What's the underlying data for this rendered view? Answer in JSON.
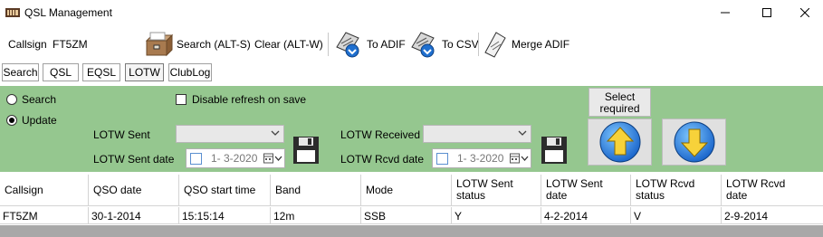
{
  "window": {
    "title": "QSL Management",
    "controls": {
      "minimize": "—",
      "maximize": "☐",
      "close": "✕"
    }
  },
  "toolbar": {
    "callsign_label": "Callsign",
    "callsign_value": "FT5ZM",
    "search_label": "Search (ALT-S)",
    "clear_label": "Clear (ALT-W)",
    "to_adif_label": "To ADIF",
    "to_csv_label": "To CSV",
    "merge_adif_label": "Merge ADIF"
  },
  "tabs": [
    {
      "label": "Search"
    },
    {
      "label": "QSL"
    },
    {
      "label": "EQSL"
    },
    {
      "label": "LOTW",
      "active": true
    },
    {
      "label": "ClubLog"
    }
  ],
  "panel": {
    "background": "#95c78f",
    "mode_search": "Search",
    "mode_update": "Update",
    "selected_mode": "Update",
    "disable_refresh_label": "Disable refresh on save",
    "disable_refresh_checked": false,
    "lotw_sent_label": "LOTW Sent",
    "lotw_sent_value": "",
    "lotw_sent_date_label": "LOTW Sent date",
    "lotw_sent_date_value": "1- 3-2020",
    "lotw_received_label": "LOTW Received",
    "lotw_received_value": "",
    "lotw_rcvd_date_label": "LOTW Rcvd date",
    "lotw_rcvd_date_value": "1- 3-2020",
    "select_required_line1": "Select",
    "select_required_line2": "required"
  },
  "grid": {
    "columns": [
      {
        "line1": "Callsign",
        "line2": ""
      },
      {
        "line1": "QSO date",
        "line2": ""
      },
      {
        "line1": "QSO start time",
        "line2": ""
      },
      {
        "line1": "Band",
        "line2": ""
      },
      {
        "line1": "Mode",
        "line2": ""
      },
      {
        "line1": "LOTW Sent",
        "line2": "status"
      },
      {
        "line1": "LOTW Sent",
        "line2": "date"
      },
      {
        "line1": "LOTW Rcvd",
        "line2": "status"
      },
      {
        "line1": "LOTW Rcvd",
        "line2": "date"
      }
    ],
    "rows": [
      [
        "FT5ZM",
        "30-1-2014",
        "15:15:14",
        "12m",
        "SSB",
        "Y",
        "4-2-2014",
        "V",
        "2-9-2014"
      ]
    ]
  }
}
